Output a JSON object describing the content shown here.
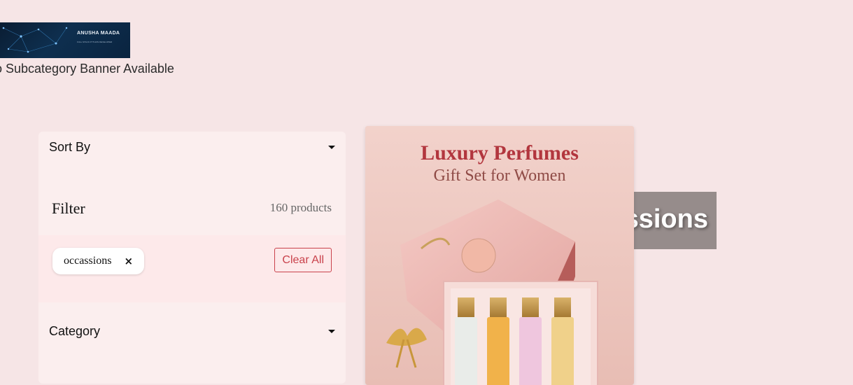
{
  "header": {
    "logo": {
      "name": "ANUSHA MAADA",
      "tagline": "FULL STACK PYTHON DEVELOPER"
    },
    "no_banner_text": "o Subcategory Banner Available"
  },
  "sidebar": {
    "sort_by_label": "Sort By",
    "filter_title": "Filter",
    "product_count": "160 products",
    "active_filter": "occassions",
    "remove_icon": "×",
    "clear_all_label": "Clear All",
    "category_label": "Category"
  },
  "overlay_banner": {
    "text": "ssions"
  },
  "product_card": {
    "title": "Luxury Perfumes",
    "subtitle": "Gift Set for Women"
  },
  "colors": {
    "page_background": "#f6e5e6",
    "accent_red": "#c9414b",
    "grey_banner": "#968c8b"
  }
}
